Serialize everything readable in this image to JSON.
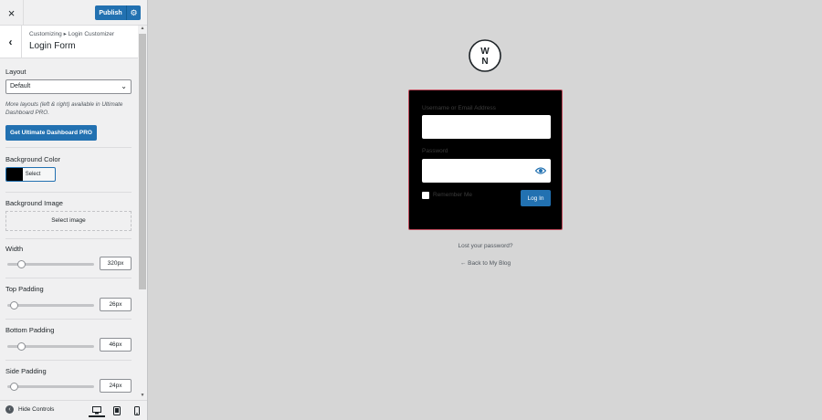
{
  "topbar": {
    "close_icon": "×",
    "publish_label": "Publish",
    "gear_icon": "⚙"
  },
  "section": {
    "back_icon": "‹",
    "breadcrumb": "Customizing ▸ Login Customizer",
    "title": "Login Form"
  },
  "layout": {
    "label": "Layout",
    "selected": "Default",
    "note": "More layouts (left & right) available in Ultimate Dashboard PRO.",
    "pro_button": "Get Ultimate Dashboard PRO"
  },
  "background_color": {
    "label": "Background Color",
    "button": "Select Color",
    "value": "#000000"
  },
  "background_image": {
    "label": "Background Image",
    "button": "Select image"
  },
  "sliders": [
    {
      "label": "Width",
      "value": "320px",
      "level": 0.16
    },
    {
      "label": "Top Padding",
      "value": "26px",
      "level": 0.08
    },
    {
      "label": "Bottom Padding",
      "value": "46px",
      "level": 0.16
    },
    {
      "label": "Side Padding",
      "value": "24px",
      "level": 0.08
    }
  ],
  "footer": {
    "hide_controls": "Hide Controls"
  },
  "preview": {
    "logo_letters": "WN",
    "username_label": "Username or Email Address",
    "password_label": "Password",
    "remember_label": "Remember Me",
    "login_button": "Log In",
    "lost_password": "Lost your password?",
    "back_to_blog": "← Back to My Blog"
  },
  "colors": {
    "accent": "#2271b1",
    "login_bg": "#000000",
    "login_border": "#c24d5e",
    "preview_bg": "#d6d6d6"
  }
}
